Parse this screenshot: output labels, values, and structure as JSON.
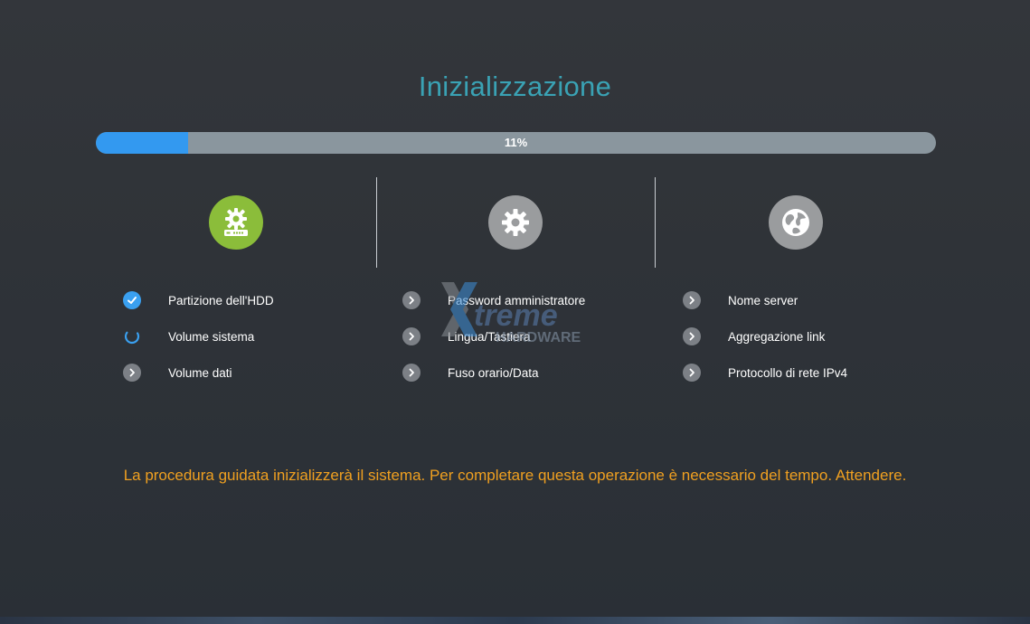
{
  "title": "Inizializzazione",
  "progress": {
    "percent": 11,
    "label": "11%"
  },
  "steps": [
    {
      "name": "disk-setup",
      "icon": "hdd-gear-icon",
      "state": "active",
      "tasks": [
        {
          "label": "Partizione dell'HDD",
          "status": "done"
        },
        {
          "label": "Volume sistema",
          "status": "loading"
        },
        {
          "label": "Volume dati",
          "status": "pending"
        }
      ]
    },
    {
      "name": "system-settings",
      "icon": "gear-icon",
      "state": "pending",
      "tasks": [
        {
          "label": "Password amministratore",
          "status": "pending"
        },
        {
          "label": "Lingua/Tastiera",
          "status": "pending"
        },
        {
          "label": "Fuso orario/Data",
          "status": "pending"
        }
      ]
    },
    {
      "name": "network-settings",
      "icon": "globe-icon",
      "state": "pending",
      "tasks": [
        {
          "label": "Nome server",
          "status": "pending"
        },
        {
          "label": "Aggregazione link",
          "status": "pending"
        },
        {
          "label": "Protocollo di rete IPv4",
          "status": "pending"
        }
      ]
    }
  ],
  "watermark": {
    "line1": "treme",
    "line2": "HARDWARE"
  },
  "notice": "La procedura guidata inizializzerà il sistema. Per completare questa operazione è necessario del tempo. Attendere.",
  "colors": {
    "title": "#3aa2b4",
    "progress_fill": "#3399f0",
    "progress_track": "#8a969e",
    "active_step": "#8bbd3a",
    "pending_step": "#9a9c9e",
    "notice": "#f0a020"
  }
}
